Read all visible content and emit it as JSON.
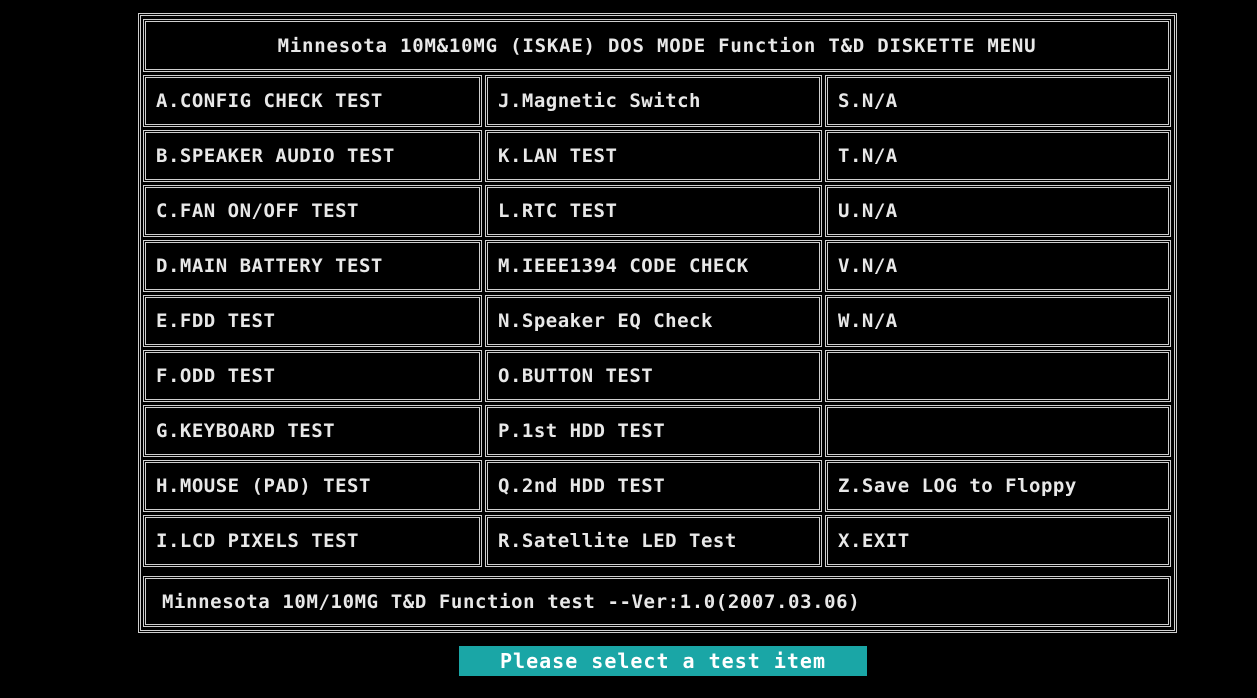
{
  "menu": {
    "title": "Minnesota 10M&10MG (ISKAE) DOS MODE Function T&D DISKETTE MENU",
    "columns": [
      [
        "A.CONFIG CHECK TEST",
        "B.SPEAKER AUDIO TEST",
        "C.FAN ON/OFF TEST",
        "D.MAIN BATTERY TEST",
        "E.FDD TEST",
        "F.ODD TEST",
        "G.KEYBOARD TEST",
        "H.MOUSE (PAD) TEST",
        "I.LCD PIXELS TEST"
      ],
      [
        "J.Magnetic Switch",
        "K.LAN TEST",
        "L.RTC TEST",
        "M.IEEE1394 CODE CHECK",
        "N.Speaker EQ Check",
        "O.BUTTON TEST",
        "P.1st HDD TEST",
        "Q.2nd HDD TEST",
        "R.Satellite LED Test"
      ],
      [
        "S.N/A",
        "T.N/A",
        "U.N/A",
        "V.N/A",
        "W.N/A",
        "",
        "",
        "Z.Save LOG to Floppy",
        "X.EXIT"
      ]
    ],
    "footer": "Minnesota 10M/10MG T&D Function test --Ver:1.0(2007.03.06)"
  },
  "prompt": {
    "text": "Please select a test item"
  },
  "colors": {
    "background": "#000000",
    "text": "#e8e8e8",
    "border": "#cfcfcf",
    "prompt_background": "#1aa6a6"
  }
}
